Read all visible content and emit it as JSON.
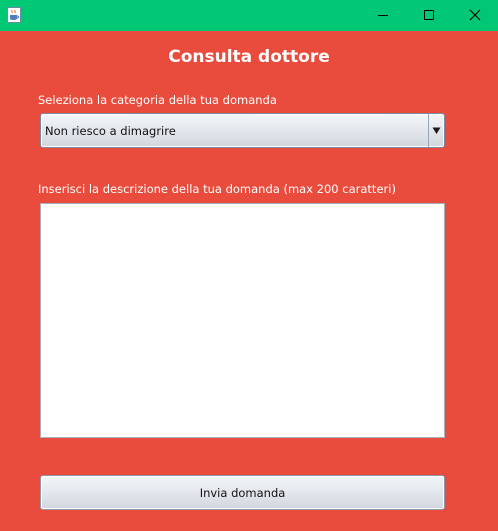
{
  "window": {
    "app_icon": "java-cup-icon",
    "controls": [
      "minimize-icon",
      "maximize-icon",
      "close-icon"
    ]
  },
  "form": {
    "title": "Consulta dottore",
    "category_label": "Seleziona la categoria della tua domanda",
    "category_selected": "Non riesco a dimagrire",
    "description_label": "Inserisci la descrizione della tua domanda (max 200 caratteri)",
    "description_value": "",
    "submit_label": "Invia domanda"
  },
  "colors": {
    "titlebar": "#00c774",
    "background": "#e94c3d",
    "text_on_background": "#ffffff"
  }
}
